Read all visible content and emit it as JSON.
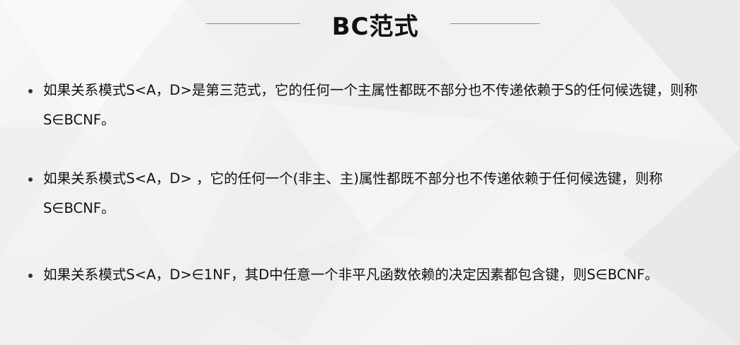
{
  "slide": {
    "title": "BC范式",
    "bullets": [
      {
        "text": "如果关系模式S<A，D>是第三范式，它的任何一个主属性都既不部分也不传递依赖于S的任何候选键，则称S∈BCNF。"
      },
      {
        "text": "如果关系模式S<A，D> ，它的任何一个(非主、主)属性都既不部分也不传递依赖于任何候选键，则称S∈BCNF。"
      },
      {
        "text": "如果关系模式S<A，D>∈1NF，其D中任意一个非平凡函数依赖的决定因素都包含键，则S∈BCNF。"
      }
    ]
  }
}
